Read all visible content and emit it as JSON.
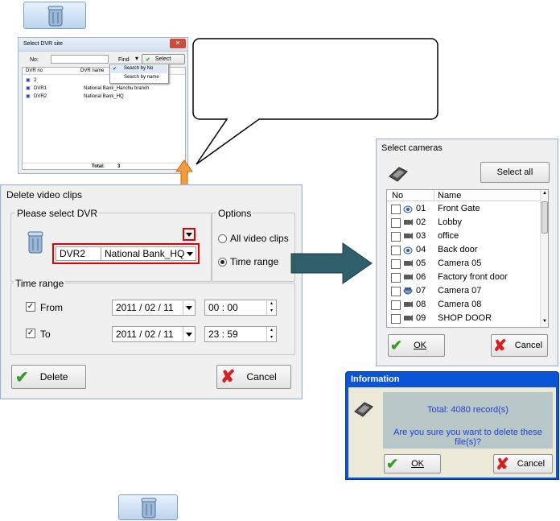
{
  "select_site_dialog": {
    "title": "Select DVR site",
    "no_label": "No:",
    "find_label": "Find",
    "select_label": "Select",
    "menu": [
      "Search by No",
      "Search by name"
    ],
    "columns": [
      "DVR no",
      "DVR name"
    ],
    "rows": [
      {
        "no": "2",
        "name": ""
      },
      {
        "no": "DVR1",
        "name": "National Bank_Hanchu branch"
      },
      {
        "no": "DVR2",
        "name": "National Bank_HQ"
      }
    ],
    "total_label": "Total:",
    "total_value": "3"
  },
  "delete_dialog": {
    "title": "Delete video clips",
    "dvr_group_label": "Please select DVR",
    "dvr_no": "DVR2",
    "dvr_name": "National Bank_HQ",
    "options_group_label": "Options",
    "option_all": "All video clips",
    "option_time": "Time range",
    "time_group_label": "Time range",
    "from_label": "From",
    "from_date": "2011 / 02 / 11",
    "from_time": "00 : 00",
    "to_label": "To",
    "to_date": "2011 / 02 / 11",
    "to_time": "23 : 59",
    "delete_label": "Delete",
    "cancel_label": "Cancel"
  },
  "cameras_dialog": {
    "title": "Select cameras",
    "select_all_label": "Select all",
    "columns": [
      "No",
      "Name"
    ],
    "cameras": [
      {
        "no": "01",
        "name": "Front Gate",
        "icon": "dome-camera-icon"
      },
      {
        "no": "02",
        "name": "Lobby",
        "icon": "box-camera-icon"
      },
      {
        "no": "03",
        "name": "office",
        "icon": "box-camera-icon"
      },
      {
        "no": "04",
        "name": "Back door",
        "icon": "dome-camera-icon"
      },
      {
        "no": "05",
        "name": "Camera 05",
        "icon": "box-camera-icon"
      },
      {
        "no": "06",
        "name": "Factory front door",
        "icon": "box-camera-icon"
      },
      {
        "no": "07",
        "name": "Camera 07",
        "icon": "speed-dome-icon"
      },
      {
        "no": "08",
        "name": "Camera 08",
        "icon": "box-camera-icon"
      },
      {
        "no": "09",
        "name": "SHOP DOOR",
        "icon": "box-camera-icon"
      }
    ],
    "ok_label": "OK",
    "cancel_label": "Cancel"
  },
  "info_dialog": {
    "title": "Information",
    "total_line": "Total:  4080 record(s)",
    "question": "Are you sure you want to delete these file(s)?",
    "ok_label": "OK",
    "cancel_label": "Cancel"
  },
  "colors": {
    "highlight_red": "#e00000",
    "arrow_orange": "#f39a3c",
    "arrow_teal": "#2f5f6a",
    "info_body": "#b8c8c8",
    "info_text": "#1f3fcf"
  }
}
